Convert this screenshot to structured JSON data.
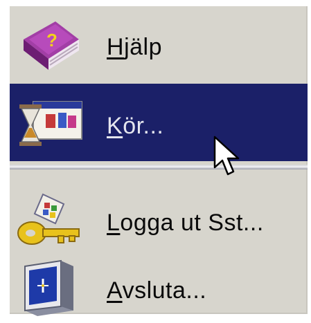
{
  "menu": {
    "items": [
      {
        "label": "Hjälp",
        "mnemonic": "H",
        "rest": "jälp",
        "icon": "help-book-icon",
        "selected": false
      },
      {
        "label": "Kör...",
        "mnemonic": "K",
        "rest": "ör...",
        "icon": "run-hourglass-icon",
        "selected": true
      },
      {
        "label": "Logga ut Sst...",
        "mnemonic": "L",
        "rest": "ogga ut Sst...",
        "icon": "logoff-key-icon",
        "selected": false
      },
      {
        "label": "Avsluta...",
        "mnemonic": "A",
        "rest": "vsluta...",
        "icon": "shutdown-monitor-icon",
        "selected": false
      }
    ]
  },
  "colors": {
    "menu_background": "#d7d5cd",
    "selection_background": "#1b2068",
    "selection_text": "#e4e5ee",
    "text": "#0a0a0a"
  }
}
